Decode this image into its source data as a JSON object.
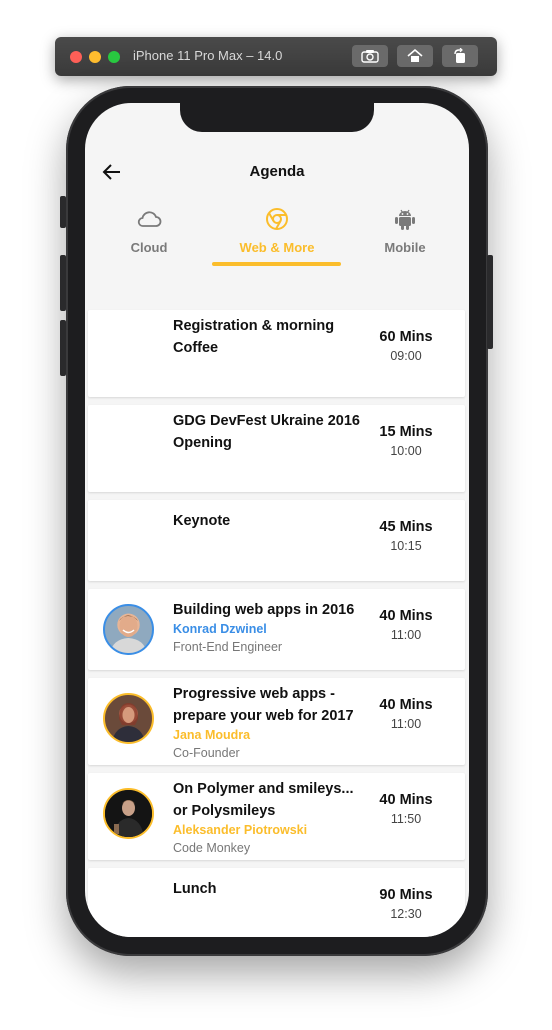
{
  "simulator": {
    "title": "iPhone 11 Pro Max – 14.0"
  },
  "header": {
    "title": "Agenda"
  },
  "tabs": [
    {
      "label": "Cloud",
      "icon": "cloud-icon",
      "active": false
    },
    {
      "label": "Web & More",
      "icon": "chrome-icon",
      "active": true
    },
    {
      "label": "Mobile",
      "icon": "android-icon",
      "active": false
    }
  ],
  "colors": {
    "accent": "#fbbd2b",
    "blue": "#3a8ee6"
  },
  "sessions": [
    {
      "title_l1": "Registration & morning",
      "title_l2": "Coffee",
      "duration": "60 Mins",
      "time": "09:00"
    },
    {
      "title_l1": "GDG DevFest Ukraine 2016",
      "title_l2": "Opening",
      "duration": "15 Mins",
      "time": "10:00"
    },
    {
      "title_l1": "Keynote",
      "duration": "45 Mins",
      "time": "10:15"
    },
    {
      "title_l1": "Building web apps in 2016",
      "speaker": "Konrad Dzwinel",
      "role": "Front-End Engineer",
      "duration": "40 Mins",
      "time": "11:00",
      "speaker_color": "#3a8ee6"
    },
    {
      "title_l1": "Progressive web apps -",
      "title_l2": "prepare your web for 2017",
      "speaker": "Jana Moudra",
      "role": "Co-Founder",
      "duration": "40 Mins",
      "time": "11:00",
      "speaker_color": "#fbbd2b"
    },
    {
      "title_l1": "On Polymer and smileys...",
      "title_l2": "or Polysmileys",
      "speaker": "Aleksander Piotrowski",
      "role": "Code Monkey",
      "duration": "40 Mins",
      "time": "11:50",
      "speaker_color": "#fbbd2b"
    },
    {
      "title_l1": "Lunch",
      "duration": "90 Mins",
      "time": "12:30"
    }
  ]
}
